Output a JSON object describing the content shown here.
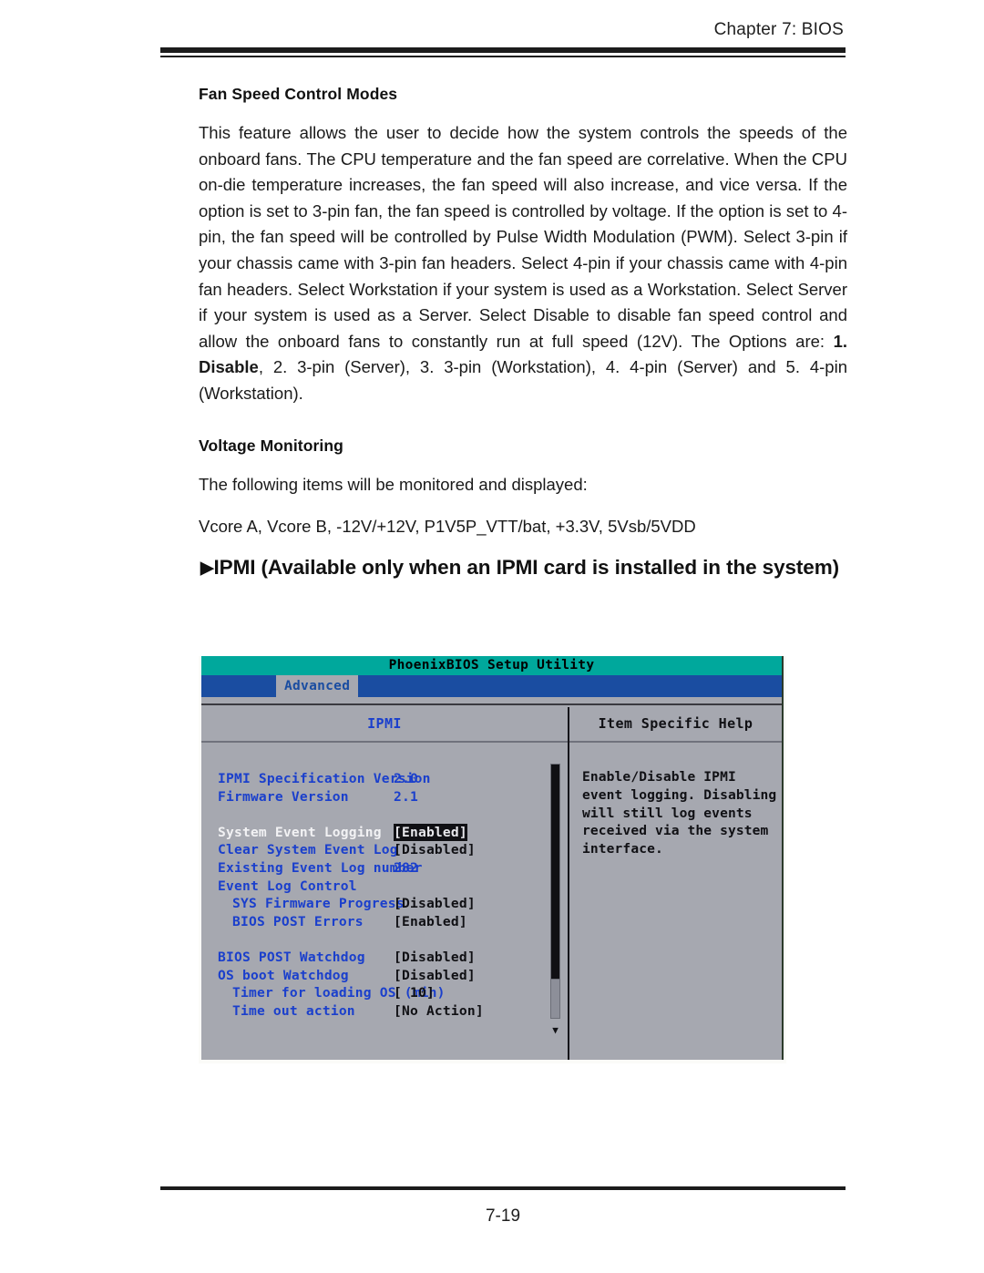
{
  "header": {
    "chapter": "Chapter 7: BIOS"
  },
  "sections": {
    "fan_speed": {
      "heading": "Fan Speed Control Modes",
      "paragraph_part1": "This feature allows the user to decide how the system controls the speeds of the onboard fans. The CPU temperature and the fan speed are correlative. When the CPU on-die temperature increases, the fan speed will also increase, and vice versa. If the option is set to 3-pin fan,  the fan speed is controlled by voltage.  If the option is set to 4-pin, the fan speed will be controlled by Pulse Width Modulation (PWM). Select 3-pin if your chassis came with 3-pin fan headers. Select 4-pin if your chassis came with 4-pin fan headers.  Select Workstation if your system is used as a Workstation. Select Server if your system  is used as a Server. Select Disable to disable fan speed control and allow the onboard fans to constantly run at full speed (12V).  The Options are: ",
      "options_bold": "1. Disable",
      "paragraph_part2": ",  2. 3-pin (Server), 3. 3-pin (Workstation),  4. 4-pin (Server) and 5. 4-pin (Workstation)."
    },
    "voltage": {
      "heading": "Voltage Monitoring",
      "intro": "The following items will be monitored and displayed:",
      "items": "Vcore A, Vcore B, -12V/+12V, P1V5P_VTT/bat, +3.3V, 5Vsb/5VDD"
    },
    "ipmi_heading": {
      "marker": "▶",
      "text": "IPMI (Available only when an IPMI card is installed in the system)"
    }
  },
  "bios": {
    "title": "PhoenixBIOS Setup Utility",
    "tab": "Advanced",
    "left_panel_title": "IPMI",
    "right_panel_title": "Item Specific Help",
    "help_text": "Enable/Disable IPMI event logging. Disabling will still log events received via the system interface.",
    "scroll_down_arrow": "▼",
    "rows": [
      {
        "label": "IPMI Specification Version",
        "value": "2.0",
        "style": "blue-value",
        "indent": false,
        "selected": false
      },
      {
        "label": "Firmware Version",
        "value": "2.1",
        "style": "blue-value",
        "indent": false,
        "selected": false
      },
      {
        "label": "",
        "value": "",
        "style": "spacer",
        "indent": false,
        "selected": false
      },
      {
        "label": "System Event Logging",
        "value": "[Enabled]",
        "style": "highlight",
        "indent": false,
        "selected": true
      },
      {
        "label": "Clear System Event Log",
        "value": "[Disabled]",
        "style": "normal",
        "indent": false,
        "selected": false
      },
      {
        "label": "Existing Event Log number",
        "value": "282",
        "style": "blue-value",
        "indent": false,
        "selected": false
      },
      {
        "label": "Event Log Control",
        "value": "",
        "style": "normal",
        "indent": false,
        "selected": false
      },
      {
        "label": "SYS Firmware Progress",
        "value": "[Disabled]",
        "style": "normal",
        "indent": true,
        "selected": false
      },
      {
        "label": "BIOS POST Errors",
        "value": "[Enabled]",
        "style": "normal",
        "indent": true,
        "selected": false
      },
      {
        "label": "",
        "value": "",
        "style": "spacer",
        "indent": false,
        "selected": false
      },
      {
        "label": "BIOS POST Watchdog",
        "value": "[Disabled]",
        "style": "normal",
        "indent": false,
        "selected": false
      },
      {
        "label": "OS boot Watchdog",
        "value": "[Disabled]",
        "style": "normal",
        "indent": false,
        "selected": false
      },
      {
        "label": "Timer for loading OS (min)",
        "value": "[ 10]",
        "style": "normal",
        "indent": true,
        "selected": false
      },
      {
        "label": "Time out action",
        "value": "[No Action]",
        "style": "normal",
        "indent": true,
        "selected": false
      }
    ],
    "colors": {
      "title_bar": "#00a89c",
      "menu_bar": "#1a4da1",
      "panel_bg": "#a6a8b0",
      "label_blue": "#1a3fcc"
    }
  },
  "footer": {
    "page_number": "7-19"
  }
}
